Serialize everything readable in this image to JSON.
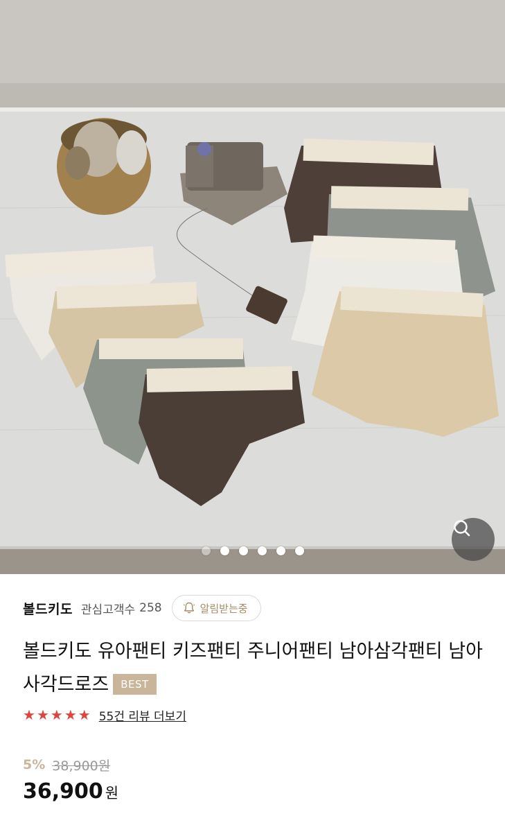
{
  "product_image": {
    "alt": "",
    "dots": 6,
    "active_dot": 0
  },
  "icons": {
    "zoom": "search-icon",
    "notify": "bell-icon",
    "star": "star-icon"
  },
  "brand": {
    "name": "볼드키도",
    "follower_label": "관심고객수",
    "follower_count": "258",
    "notify_label": "알림받는중"
  },
  "product": {
    "title": "볼드키도 유아팬티 키즈팬티 주니어팬티 남아삼각팬티 남아사각드로즈",
    "badge": "BEST"
  },
  "reviews": {
    "rating": 5,
    "link_label": "55건 리뷰 더보기"
  },
  "price": {
    "discount_rate": "5%",
    "original": "38,900원",
    "current": "36,900",
    "currency": "원"
  },
  "colors": {
    "badge": "#c9b59a",
    "star": "#e0443e",
    "discount": "#c9b59a"
  }
}
